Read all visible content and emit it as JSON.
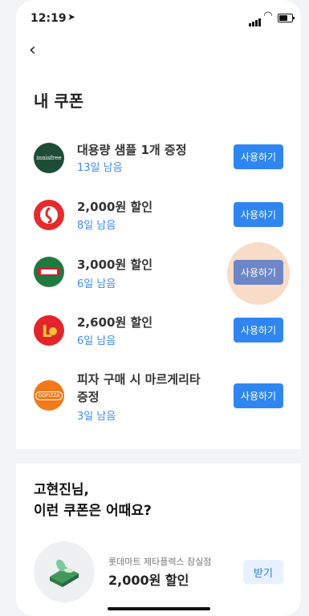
{
  "status": {
    "time": "12:19",
    "battery_level": 0.7
  },
  "header": {
    "title": "내 쿠폰"
  },
  "coupons": [
    {
      "brand": "innisfree",
      "title": "대용량 샘플 1개 증정",
      "remaining": "13일 남음",
      "button": "사용하기",
      "color": "#1e4c37"
    },
    {
      "brand": "",
      "title": "2,000원 할인",
      "remaining": "8일 남음",
      "button": "사용하기",
      "color": "#e52b2b"
    },
    {
      "brand": "Krispy Kreme",
      "title": "3,000원 할인",
      "remaining": "6일 남음",
      "button": "사용하기",
      "color": "#1f7a3f"
    },
    {
      "brand": "L",
      "title": "2,600원 할인",
      "remaining": "6일 남음",
      "button": "사용하기",
      "color": "#e3242b"
    },
    {
      "brand": "GOPIZZA",
      "title_line1": "피자 구매 시 마르게리타",
      "title_line2": "증정",
      "remaining": "3일 남음",
      "button": "사용하기",
      "color": "#f07a1a"
    }
  ],
  "recommend": {
    "title_line1": "고현진님,",
    "title_line2": "이런 쿠폰은 어때요?",
    "store": "롯데마트 제타플렉스 잠실점",
    "offer": "2,000원 할인",
    "button": "받기"
  }
}
